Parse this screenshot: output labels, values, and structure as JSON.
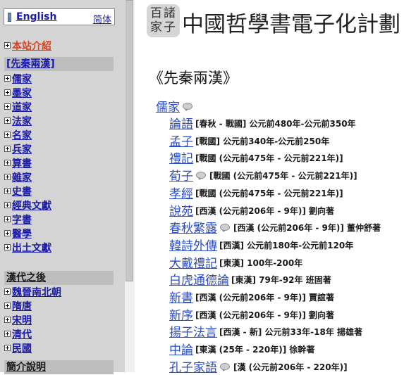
{
  "sidebar": {
    "english_link": "English",
    "simplified_link": "简体",
    "intro": "本站介紹",
    "section_pre_qin": "[先秦兩漢]",
    "pre_qin_items": [
      {
        "label": "儒家"
      },
      {
        "label": "墨家"
      },
      {
        "label": "道家"
      },
      {
        "label": "法家"
      },
      {
        "label": "名家"
      },
      {
        "label": "兵家"
      },
      {
        "label": "算書"
      },
      {
        "label": "雜家"
      },
      {
        "label": "史書"
      },
      {
        "label": "經典文獻"
      },
      {
        "label": "字書"
      },
      {
        "label": "醫學"
      },
      {
        "label": "出土文獻"
      }
    ],
    "section_han_after": "漢代之後",
    "han_after_items": [
      {
        "label": "魏晉南北朝"
      },
      {
        "label": "隋唐"
      },
      {
        "label": "宋明"
      },
      {
        "label": "清代"
      },
      {
        "label": "民國"
      }
    ],
    "section_intro_notes": "簡介說明"
  },
  "header": {
    "logo_chars": [
      "百",
      "諸",
      "家",
      "子"
    ],
    "site_title": "中國哲學書電子化計劃"
  },
  "main": {
    "page_title": "《先秦兩漢》",
    "school": "儒家",
    "school_icon": "discussion-bubble-icon",
    "books": [
      {
        "title": "論語",
        "info": "[春秋 - 戰國] 公元前480年-公元前350年",
        "has_bubble": false
      },
      {
        "title": "孟子",
        "info": "[戰國] 公元前340年-公元前250年",
        "has_bubble": false
      },
      {
        "title": "禮記",
        "info": "[戰國 (公元前475年 - 公元前221年)]",
        "has_bubble": false
      },
      {
        "title": "荀子",
        "info": "[戰國 (公元前475年 - 公元前221年)]",
        "has_bubble": true
      },
      {
        "title": "孝經",
        "info": "[戰國 (公元前475年 - 公元前221年)]",
        "has_bubble": false
      },
      {
        "title": "說苑",
        "info": "[西漢 (公元前206年 - 9年)] 劉向著",
        "has_bubble": false
      },
      {
        "title": "春秋繁露",
        "info": "[西漢 (公元前206年 - 9年)] 董仲舒著",
        "has_bubble": true
      },
      {
        "title": "韓詩外傳",
        "info": "[西漢] 公元前180年-公元前120年",
        "has_bubble": false
      },
      {
        "title": "大戴禮記",
        "info": "[東漢] 100年-200年",
        "has_bubble": false
      },
      {
        "title": "白虎通德論",
        "info": "[東漢] 79年-92年 班固著",
        "has_bubble": false
      },
      {
        "title": "新書",
        "info": "[西漢 (公元前206年 - 9年)] 賈誼著",
        "has_bubble": false
      },
      {
        "title": "新序",
        "info": "[西漢 (公元前206年 - 9年)] 劉向著",
        "has_bubble": false
      },
      {
        "title": "揚子法言",
        "info": "[西漢 - 新] 公元前33年-18年 揚雄著",
        "has_bubble": false
      },
      {
        "title": "中論",
        "info": "[東漢 (25年 - 220年)] 徐幹著",
        "has_bubble": false
      },
      {
        "title": "孔子家語",
        "info": "[漢 (公元前206年 - 220年)]",
        "has_bubble": true
      }
    ]
  },
  "colors": {
    "sidebar_bg": "#d4d4d4",
    "section_bg": "#bdbdbd",
    "link_blue": "#1a1aa6",
    "book_link_blue": "#2a4cc9",
    "current_orange": "#e0401a"
  }
}
